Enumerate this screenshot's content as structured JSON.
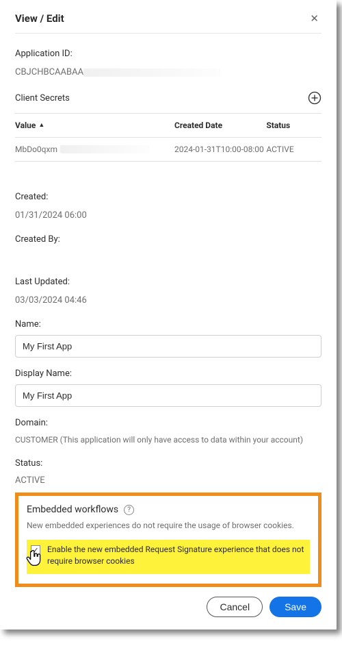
{
  "dialog": {
    "title": "View / Edit"
  },
  "app_id": {
    "label": "Application ID:",
    "value": "CBJCHBCAABAA"
  },
  "secrets": {
    "label": "Client Secrets",
    "columns": {
      "value": "Value",
      "created": "Created Date",
      "status": "Status"
    },
    "rows": [
      {
        "value": "MbDo0qxm",
        "created": "2024-01-31T10:00-08:00",
        "status": "ACTIVE"
      }
    ]
  },
  "created": {
    "label": "Created:",
    "value": "01/31/2024 06:00"
  },
  "created_by": {
    "label": "Created By:"
  },
  "last_updated": {
    "label": "Last Updated:",
    "value": "03/03/2024 04:46"
  },
  "name": {
    "label": "Name:",
    "value": "My First App"
  },
  "display_name": {
    "label": "Display Name:",
    "value": "My First App"
  },
  "domain": {
    "label": "Domain:",
    "value": "CUSTOMER (This application will only have access to data within your account)"
  },
  "status": {
    "label": "Status:",
    "value": "ACTIVE"
  },
  "workflows": {
    "title": "Embedded workflows",
    "desc": "New embedded experiences do not require the usage of browser cookies.",
    "checkbox_label": "Enable the new embedded Request Signature experience that does not require browser cookies",
    "checked": true
  },
  "buttons": {
    "cancel": "Cancel",
    "save": "Save"
  }
}
